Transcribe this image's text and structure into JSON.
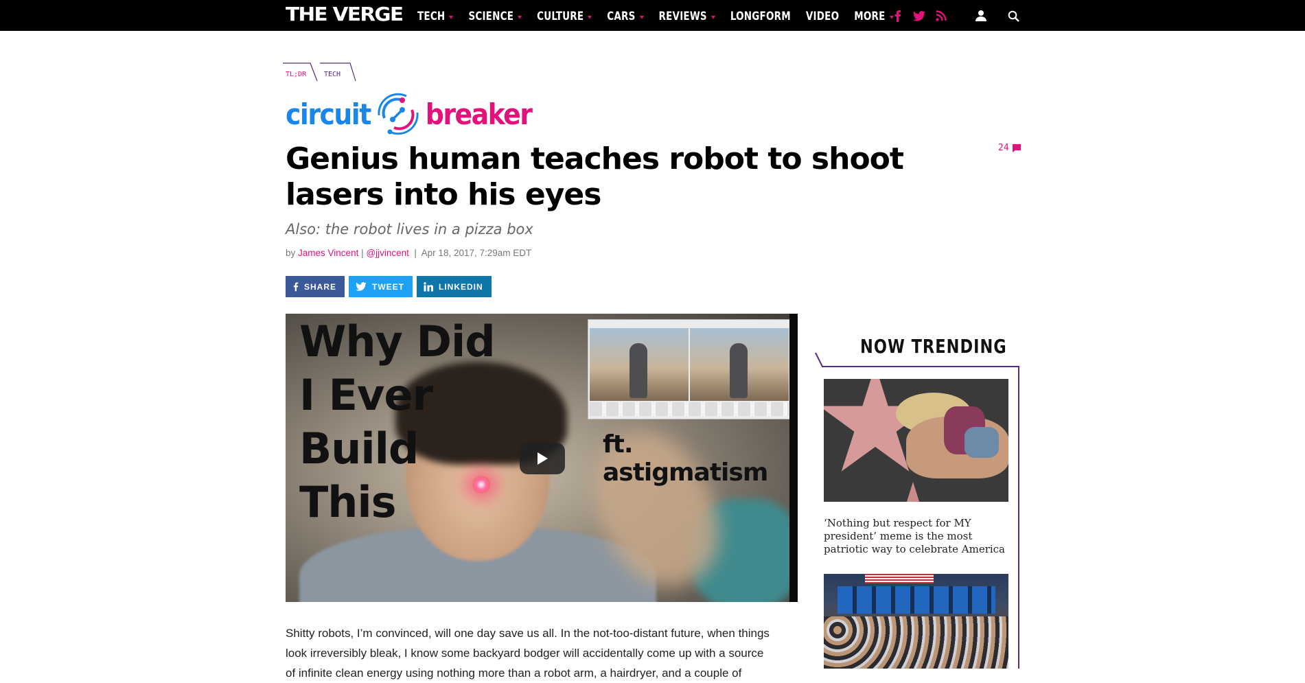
{
  "site": {
    "logo": "THE VERGE"
  },
  "nav": {
    "items": [
      {
        "label": "TECH",
        "dropdown": true
      },
      {
        "label": "SCIENCE",
        "dropdown": true
      },
      {
        "label": "CULTURE",
        "dropdown": true
      },
      {
        "label": "CARS",
        "dropdown": true
      },
      {
        "label": "REVIEWS",
        "dropdown": true
      },
      {
        "label": "LONGFORM",
        "dropdown": false
      },
      {
        "label": "VIDEO",
        "dropdown": false
      },
      {
        "label": "MORE",
        "dropdown": true
      }
    ],
    "icons": [
      "facebook-icon",
      "twitter-icon",
      "rss-icon",
      "user-icon",
      "search-icon"
    ]
  },
  "breadcrumb": {
    "first": "TL;DR",
    "second": "TECH"
  },
  "section_brand": {
    "left": "circuit",
    "right": "breaker"
  },
  "article": {
    "title": "Genius human teaches robot to shoot lasers into his eyes",
    "dek": "Also: the robot lives in a pizza box",
    "byline": {
      "prefix": "by",
      "author": "James Vincent",
      "sep1": "|",
      "handle": "@jjvincent",
      "sep2": "|",
      "date": "Apr 18, 2017, 7:29am EDT"
    },
    "comment_count": "24",
    "body_lines": [
      "Shitty robots, I’m convinced, will one day save us all. In the not-too-distant future, when things",
      "look irreversibly bleak, I know some backyard bodger will accidentally come up with a source",
      "of infinite clean energy using nothing more than a robot arm, a hairdryer, and a couple of"
    ]
  },
  "share": {
    "buttons": [
      {
        "label": "SHARE",
        "color": "#3b5998",
        "icon": "facebook-icon"
      },
      {
        "label": "TWEET",
        "color": "#1da1f2",
        "icon": "twitter-icon"
      },
      {
        "label": "LINKEDIN",
        "color": "#0e76a8",
        "icon": "linkedin-icon"
      }
    ]
  },
  "video": {
    "overlay_lines": [
      "Why Did",
      "I Ever",
      "Build",
      "This"
    ],
    "overlay_right": "ft. astigmatism"
  },
  "trending": {
    "heading": "NOW TRENDING",
    "items": [
      {
        "caption": "‘Nothing but respect for MY president’ meme is the most patriotic way to celebrate America"
      },
      {
        "caption": ""
      }
    ]
  },
  "colors": {
    "accent": "#e2127a",
    "brand_blue": "#1a86e8",
    "nav_bg": "#000000",
    "frame": "#5a2a82"
  }
}
